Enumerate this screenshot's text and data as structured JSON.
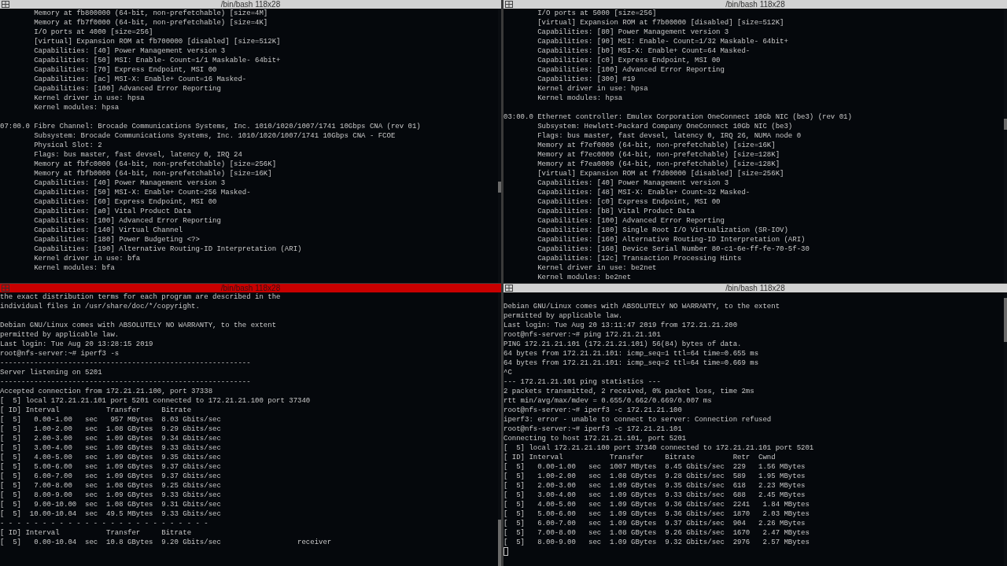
{
  "panes": [
    {
      "title": "/bin/bash 118x28",
      "selected": false,
      "lines": [
        {
          "kind": "text",
          "text": "        Memory at fb800000 (64-bit, non-prefetchable) [size=4M]"
        },
        {
          "kind": "text",
          "text": "        Memory at fb7f0000 (64-bit, non-prefetchable) [size=4K]"
        },
        {
          "kind": "text",
          "text": "        I/O ports at 4000 [size=256]"
        },
        {
          "kind": "text",
          "text": "        [virtual] Expansion ROM at fb700000 [disabled] [size=512K]"
        },
        {
          "kind": "text",
          "text": "        Capabilities: [40] Power Management version 3"
        },
        {
          "kind": "text",
          "text": "        Capabilities: [50] MSI: Enable- Count=1/1 Maskable- 64bit+"
        },
        {
          "kind": "text",
          "text": "        Capabilities: [70] Express Endpoint, MSI 00"
        },
        {
          "kind": "text",
          "text": "        Capabilities: [ac] MSI-X: Enable+ Count=16 Masked-"
        },
        {
          "kind": "text",
          "text": "        Capabilities: [100] Advanced Error Reporting"
        },
        {
          "kind": "text",
          "text": "        Kernel driver in use: hpsa"
        },
        {
          "kind": "text",
          "text": "        Kernel modules: hpsa"
        },
        {
          "kind": "blank"
        },
        {
          "kind": "text",
          "text": "07:00.0 Fibre Channel: Brocade Communications Systems, Inc. 1010/1020/1007/1741 10Gbps CNA (rev 01)"
        },
        {
          "kind": "text",
          "text": "        Subsystem: Brocade Communications Systems, Inc. 1010/1020/1007/1741 10Gbps CNA - FCOE"
        },
        {
          "kind": "text",
          "text": "        Physical Slot: 2"
        },
        {
          "kind": "text",
          "text": "        Flags: bus master, fast devsel, latency 0, IRQ 24"
        },
        {
          "kind": "text",
          "text": "        Memory at fbfc0000 (64-bit, non-prefetchable) [size=256K]"
        },
        {
          "kind": "text",
          "text": "        Memory at fbfb0000 (64-bit, non-prefetchable) [size=16K]"
        },
        {
          "kind": "text",
          "text": "        Capabilities: [40] Power Management version 3"
        },
        {
          "kind": "text",
          "text": "        Capabilities: [50] MSI-X: Enable+ Count=256 Masked-"
        },
        {
          "kind": "text",
          "text": "        Capabilities: [60] Express Endpoint, MSI 00"
        },
        {
          "kind": "text",
          "text": "        Capabilities: [a0] Vital Product Data"
        },
        {
          "kind": "text",
          "text": "        Capabilities: [100] Advanced Error Reporting"
        },
        {
          "kind": "text",
          "text": "        Capabilities: [140] Virtual Channel"
        },
        {
          "kind": "text",
          "text": "        Capabilities: [180] Power Budgeting <?>"
        },
        {
          "kind": "text",
          "text": "        Capabilities: [190] Alternative Routing-ID Interpretation (ARI)"
        },
        {
          "kind": "text",
          "text": "        Kernel driver in use: bfa"
        },
        {
          "kind": "text",
          "text": "        Kernel modules: bfa"
        }
      ]
    },
    {
      "title": "/bin/bash 118x28",
      "selected": false,
      "lines": [
        {
          "kind": "text",
          "text": "        I/O ports at 5000 [size=256]"
        },
        {
          "kind": "text",
          "text": "        [virtual] Expansion ROM at f7b00000 [disabled] [size=512K]"
        },
        {
          "kind": "text",
          "text": "        Capabilities: [80] Power Management version 3"
        },
        {
          "kind": "text",
          "text": "        Capabilities: [90] MSI: Enable- Count=1/32 Maskable- 64bit+"
        },
        {
          "kind": "text",
          "text": "        Capabilities: [b0] MSI-X: Enable+ Count=64 Masked-"
        },
        {
          "kind": "text",
          "text": "        Capabilities: [c0] Express Endpoint, MSI 00"
        },
        {
          "kind": "text",
          "text": "        Capabilities: [100] Advanced Error Reporting"
        },
        {
          "kind": "text",
          "text": "        Capabilities: [300] #19"
        },
        {
          "kind": "text",
          "text": "        Kernel driver in use: hpsa"
        },
        {
          "kind": "text",
          "text": "        Kernel modules: hpsa"
        },
        {
          "kind": "blank"
        },
        {
          "kind": "text",
          "text": "03:00.0 Ethernet controller: Emulex Corporation OneConnect 10Gb NIC (be3) (rev 01)"
        },
        {
          "kind": "text",
          "text": "        Subsystem: Hewlett-Packard Company OneConnect 10Gb NIC (be3)"
        },
        {
          "kind": "text",
          "text": "        Flags: bus master, fast devsel, latency 0, IRQ 26, NUMA node 0"
        },
        {
          "kind": "text",
          "text": "        Memory at f7ef0000 (64-bit, non-prefetchable) [size=16K]"
        },
        {
          "kind": "text",
          "text": "        Memory at f7ec0000 (64-bit, non-prefetchable) [size=128K]"
        },
        {
          "kind": "text",
          "text": "        Memory at f7ea0000 (64-bit, non-prefetchable) [size=128K]"
        },
        {
          "kind": "text",
          "text": "        [virtual] Expansion ROM at f7d00000 [disabled] [size=256K]"
        },
        {
          "kind": "text",
          "text": "        Capabilities: [40] Power Management version 3"
        },
        {
          "kind": "text",
          "text": "        Capabilities: [48] MSI-X: Enable+ Count=32 Masked-"
        },
        {
          "kind": "text",
          "text": "        Capabilities: [c0] Express Endpoint, MSI 00"
        },
        {
          "kind": "text",
          "text": "        Capabilities: [b8] Vital Product Data"
        },
        {
          "kind": "text",
          "text": "        Capabilities: [100] Advanced Error Reporting"
        },
        {
          "kind": "text",
          "text": "        Capabilities: [180] Single Root I/O Virtualization (SR-IOV)"
        },
        {
          "kind": "text",
          "text": "        Capabilities: [160] Alternative Routing-ID Interpretation (ARI)"
        },
        {
          "kind": "text",
          "text": "        Capabilities: [168] Device Serial Number 80-c1-6e-ff-fe-70-5f-30"
        },
        {
          "kind": "text",
          "text": "        Capabilities: [12c] Transaction Processing Hints"
        },
        {
          "kind": "text",
          "text": "        Kernel driver in use: be2net"
        },
        {
          "kind": "text",
          "text": "        Kernel modules: be2net"
        }
      ]
    },
    {
      "title": "/bin/bash 118x28",
      "selected": true,
      "lines": [
        {
          "kind": "text",
          "text": "the exact distribution terms for each program are described in the"
        },
        {
          "kind": "text",
          "text": "individual files in /usr/share/doc/*/copyright."
        },
        {
          "kind": "blank"
        },
        {
          "kind": "text",
          "text": "Debian GNU/Linux comes with ABSOLUTELY NO WARRANTY, to the extent"
        },
        {
          "kind": "text",
          "text": "permitted by applicable law."
        },
        {
          "kind": "text",
          "text": "Last login: Tue Aug 20 13:28:15 2019"
        },
        {
          "kind": "text",
          "text": "root@nfs-server:~# iperf3 -s"
        },
        {
          "kind": "text",
          "text": "-----------------------------------------------------------"
        },
        {
          "kind": "text",
          "text": "Server listening on 5201"
        },
        {
          "kind": "text",
          "text": "-----------------------------------------------------------"
        },
        {
          "kind": "text",
          "text": "Accepted connection from 172.21.21.100, port 37338"
        },
        {
          "kind": "text",
          "text": "[  5] local 172.21.21.101 port 5201 connected to 172.21.21.100 port 37340"
        },
        {
          "kind": "text",
          "text": "[ ID] Interval           Transfer     Bitrate"
        },
        {
          "kind": "text",
          "text": "[  5]   0.00-1.00   sec   957 MBytes  8.03 Gbits/sec"
        },
        {
          "kind": "text",
          "text": "[  5]   1.00-2.00   sec  1.08 GBytes  9.29 Gbits/sec"
        },
        {
          "kind": "text",
          "text": "[  5]   2.00-3.00   sec  1.09 GBytes  9.34 Gbits/sec"
        },
        {
          "kind": "text",
          "text": "[  5]   3.00-4.00   sec  1.09 GBytes  9.33 Gbits/sec"
        },
        {
          "kind": "text",
          "text": "[  5]   4.00-5.00   sec  1.09 GBytes  9.35 Gbits/sec"
        },
        {
          "kind": "text",
          "text": "[  5]   5.00-6.00   sec  1.09 GBytes  9.37 Gbits/sec"
        },
        {
          "kind": "text",
          "text": "[  5]   6.00-7.00   sec  1.09 GBytes  9.37 Gbits/sec"
        },
        {
          "kind": "text",
          "text": "[  5]   7.00-8.00   sec  1.08 GBytes  9.25 Gbits/sec"
        },
        {
          "kind": "text",
          "text": "[  5]   8.00-9.00   sec  1.09 GBytes  9.33 Gbits/sec"
        },
        {
          "kind": "text",
          "text": "[  5]   9.00-10.00  sec  1.08 GBytes  9.31 Gbits/sec"
        },
        {
          "kind": "text",
          "text": "[  5]  10.00-10.04  sec  49.5 MBytes  9.33 Gbits/sec"
        },
        {
          "kind": "text",
          "text": "- - - - - - - - - - - - - - - - - - - - - - - - -"
        },
        {
          "kind": "text",
          "text": "[ ID] Interval           Transfer     Bitrate"
        },
        {
          "kind": "text",
          "text": "[  5]   0.00-10.04  sec  10.8 GBytes  9.20 Gbits/sec                  receiver"
        }
      ]
    },
    {
      "title": "/bin/bash 118x28",
      "selected": false,
      "cursor": true,
      "lines": [
        {
          "kind": "blank"
        },
        {
          "kind": "text",
          "text": "Debian GNU/Linux comes with ABSOLUTELY NO WARRANTY, to the extent"
        },
        {
          "kind": "text",
          "text": "permitted by applicable law."
        },
        {
          "kind": "text",
          "text": "Last login: Tue Aug 20 13:11:47 2019 from 172.21.21.200"
        },
        {
          "kind": "text",
          "text": "root@nfs-server:~# ping 172.21.21.101"
        },
        {
          "kind": "text",
          "text": "PING 172.21.21.101 (172.21.21.101) 56(84) bytes of data."
        },
        {
          "kind": "text",
          "text": "64 bytes from 172.21.21.101: icmp_seq=1 ttl=64 time=0.655 ms"
        },
        {
          "kind": "text",
          "text": "64 bytes from 172.21.21.101: icmp_seq=2 ttl=64 time=0.669 ms"
        },
        {
          "kind": "text",
          "text": "^C"
        },
        {
          "kind": "text",
          "text": "--- 172.21.21.101 ping statistics ---"
        },
        {
          "kind": "text",
          "text": "2 packets transmitted, 2 received, 0% packet loss, time 2ms"
        },
        {
          "kind": "text",
          "text": "rtt min/avg/max/mdev = 0.655/0.662/0.669/0.007 ms"
        },
        {
          "kind": "text",
          "text": "root@nfs-server:~# iperf3 -c 172.21.21.100"
        },
        {
          "kind": "text",
          "text": "iperf3: error - unable to connect to server: Connection refused"
        },
        {
          "kind": "text",
          "text": "root@nfs-server:~# iperf3 -c 172.21.21.101"
        },
        {
          "kind": "text",
          "text": "Connecting to host 172.21.21.101, port 5201"
        },
        {
          "kind": "text",
          "text": "[  5] local 172.21.21.100 port 37340 connected to 172.21.21.101 port 5201"
        },
        {
          "kind": "text",
          "text": "[ ID] Interval           Transfer     Bitrate         Retr  Cwnd"
        },
        {
          "kind": "text",
          "text": "[  5]   0.00-1.00   sec  1007 MBytes  8.45 Gbits/sec  229   1.56 MBytes"
        },
        {
          "kind": "text",
          "text": "[  5]   1.00-2.00   sec  1.08 GBytes  9.28 Gbits/sec  589   1.95 MBytes"
        },
        {
          "kind": "text",
          "text": "[  5]   2.00-3.00   sec  1.09 GBytes  9.35 Gbits/sec  618   2.23 MBytes"
        },
        {
          "kind": "text",
          "text": "[  5]   3.00-4.00   sec  1.09 GBytes  9.33 Gbits/sec  688   2.45 MBytes"
        },
        {
          "kind": "text",
          "text": "[  5]   4.00-5.00   sec  1.09 GBytes  9.36 Gbits/sec  2241   1.84 MBytes"
        },
        {
          "kind": "text",
          "text": "[  5]   5.00-6.00   sec  1.09 GBytes  9.36 Gbits/sec  1870   2.03 MBytes"
        },
        {
          "kind": "text",
          "text": "[  5]   6.00-7.00   sec  1.09 GBytes  9.37 Gbits/sec  904   2.26 MBytes"
        },
        {
          "kind": "text",
          "text": "[  5]   7.00-8.00   sec  1.08 GBytes  9.26 Gbits/sec  1670   2.47 MBytes"
        },
        {
          "kind": "text",
          "text": "[  5]   8.00-9.00   sec  1.09 GBytes  9.32 Gbits/sec  2976   2.57 MBytes"
        }
      ]
    }
  ]
}
